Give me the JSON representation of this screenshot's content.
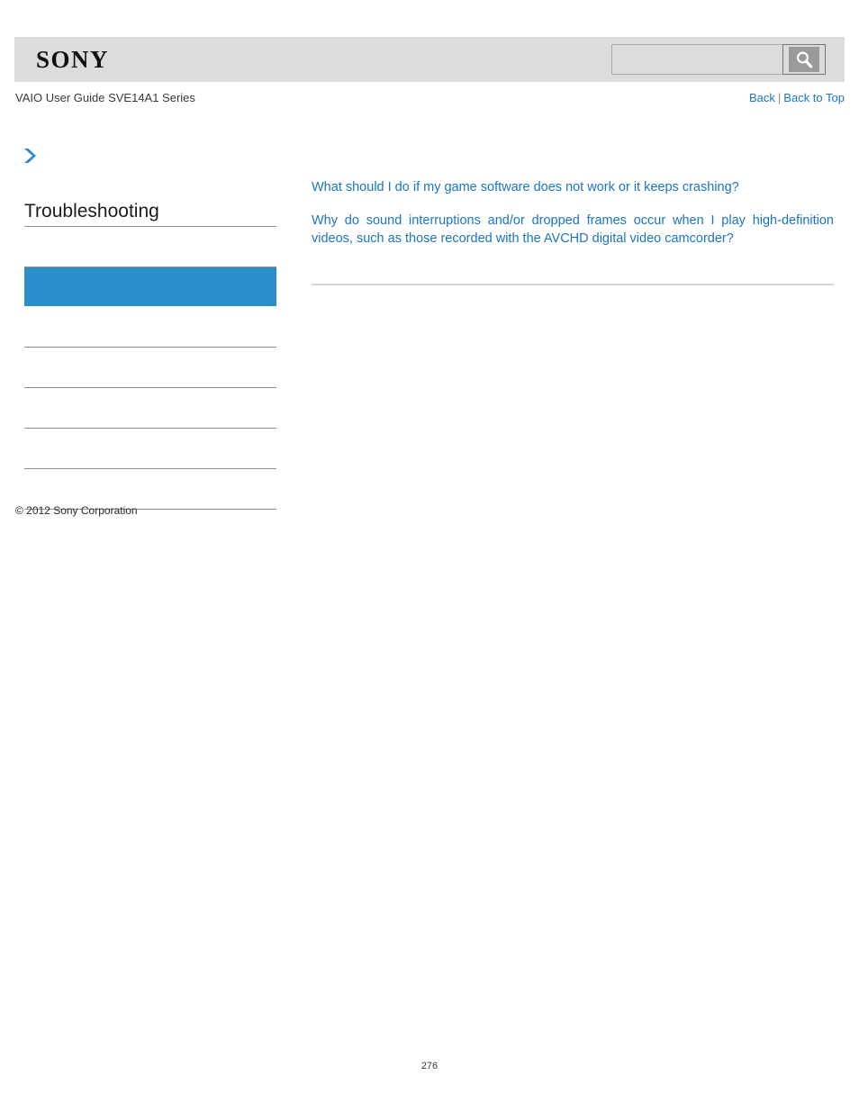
{
  "header": {
    "logo_text": "SONY",
    "search": {
      "value": "",
      "placeholder": "",
      "button_icon": "search-icon"
    }
  },
  "subheader": {
    "guide_title": "VAIO User Guide SVE14A1 Series",
    "back_label": "Back",
    "separator": "|",
    "back_to_top_label": "Back to Top"
  },
  "sidebar": {
    "breadcrumb_icon": "chevron-right-icon",
    "title": "Troubleshooting",
    "items": [
      {
        "label": "",
        "selected": true
      },
      {
        "label": "",
        "selected": false
      },
      {
        "label": "",
        "selected": false
      },
      {
        "label": "",
        "selected": false
      },
      {
        "label": "",
        "selected": false
      },
      {
        "label": "",
        "selected": false
      }
    ],
    "copyright": "© 2012 Sony Corporation"
  },
  "main": {
    "links": [
      "What should I do if my game software does not work or it keeps crashing?",
      "Why do sound interruptions and/or dropped frames occur when I play high-definition videos, such as those recorded with the AVCHD digital video camcorder?"
    ]
  },
  "footer": {
    "page_number": "276"
  },
  "colors": {
    "link_blue": "#1a75c4",
    "selected_blue": "#2b8fcc",
    "header_gray": "#dcdcdc",
    "rule_gray": "#8f8f8f"
  }
}
